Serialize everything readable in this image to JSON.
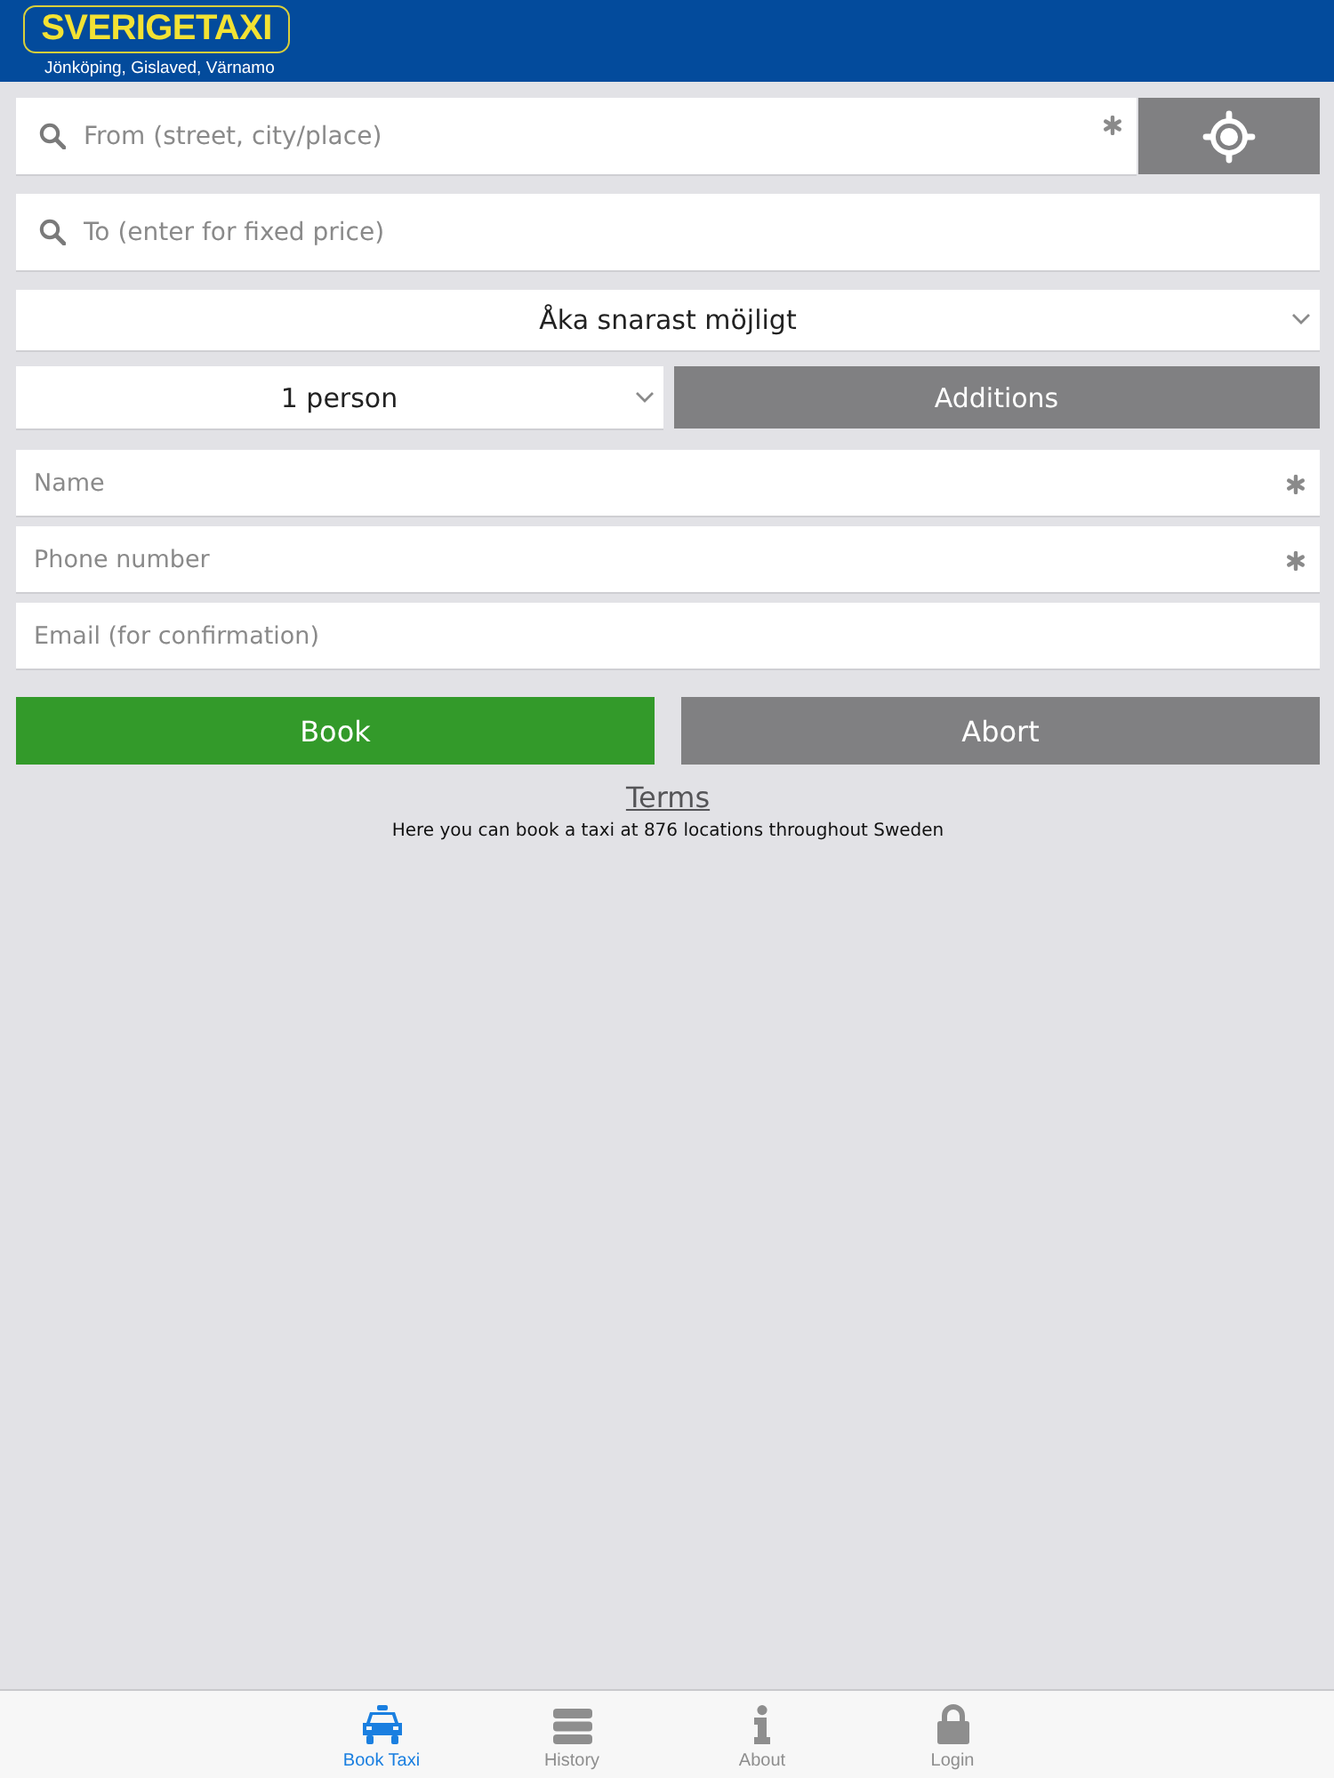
{
  "header": {
    "logo": "SVERIGETAXI",
    "subtitle": "Jönköping, Gislaved, Värnamo"
  },
  "address_fields": [
    {
      "placeholder": "From (street, city/place)",
      "required": true,
      "locate_button": true
    },
    {
      "placeholder": "To (enter for fixed price)",
      "required": false,
      "locate_button": false
    }
  ],
  "time_select": {
    "value": "Åka snarast möjligt"
  },
  "passengers_select": {
    "value": "1 person"
  },
  "additions_button": {
    "label": "Additions"
  },
  "contact_fields": [
    {
      "placeholder": "Name",
      "required": true
    },
    {
      "placeholder": "Phone number",
      "required": true
    },
    {
      "placeholder": "Email (for confirmation)",
      "required": false
    }
  ],
  "actions": [
    {
      "label": "Book",
      "kind": "primary"
    },
    {
      "label": "Abort",
      "kind": "secondary"
    }
  ],
  "terms_link": "Terms",
  "info_text": "Here you can book a taxi at 876 locations throughout Sweden",
  "tab_bar": [
    {
      "label": "Book Taxi",
      "kind": "taxi",
      "selected": true
    },
    {
      "label": "History",
      "kind": "history",
      "selected": false
    },
    {
      "label": "About",
      "kind": "about",
      "selected": false
    },
    {
      "label": "Login",
      "kind": "login",
      "selected": false
    }
  ]
}
